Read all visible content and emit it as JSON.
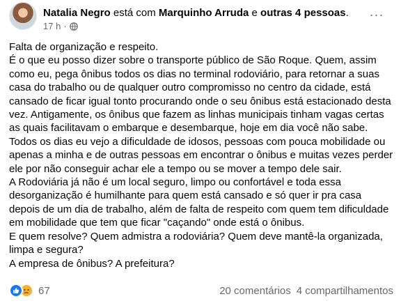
{
  "post": {
    "author": "Natalia Negro",
    "with_text": "está com",
    "tagged": "Marquinho Arruda",
    "and_text": "e",
    "others": "outras 4 pessoas",
    "period": ".",
    "time": "17 h",
    "separator": "·",
    "privacy_icon": "globe-icon",
    "more_label": "···"
  },
  "body": {
    "lines": [
      "Falta de organização e respeito.",
      "É o que eu posso dizer sobre o transporte público de São Roque. Quem, assim como eu, pega ônibus todos os dias no terminal rodoviário, para retornar a suas casa do trabalho ou de qualquer outro compromisso no centro da cidade, está cansado de ficar igual tonto procurando onde o seu ônibus está estacionado desta vez. Antigamente, os ônibus que fazem as linhas municipais tinham vagas certas as quais facilitavam o embarque e desembarque, hoje em dia você não sabe. Todos os dias eu vejo a dificuldade de idosos, pessoas com pouca mobilidade ou apenas a minha e de outras pessoas em encontrar o ônibus e muitas vezes perder ele por não conseguir achar ele a tempo ou se mover a tempo dele sair.",
      "A Rodoviária já não é um local seguro, limpo ou confortável e toda essa desorganização é humilhante para quem está cansado e só quer ir pra casa depois de um dia de trabalho, além de falta de respeito com quem tem dificuldade em mobilidade que tem que ficar \"caçando\" onde está o ônibus.",
      "E quem resolve? Quem admistra a rodoviária? Quem deve mantê-la organizada, limpa e segura?",
      "A empresa de ônibus? A prefeitura?"
    ]
  },
  "footer": {
    "reactions": [
      "like-icon",
      "sad-icon"
    ],
    "reaction_count": "67",
    "comments": "20 comentários",
    "shares": "4 compartilhamentos"
  },
  "colors": {
    "text": "#050505",
    "secondary": "#65676b",
    "like": "#1877f2",
    "sad": "#f7b125"
  }
}
